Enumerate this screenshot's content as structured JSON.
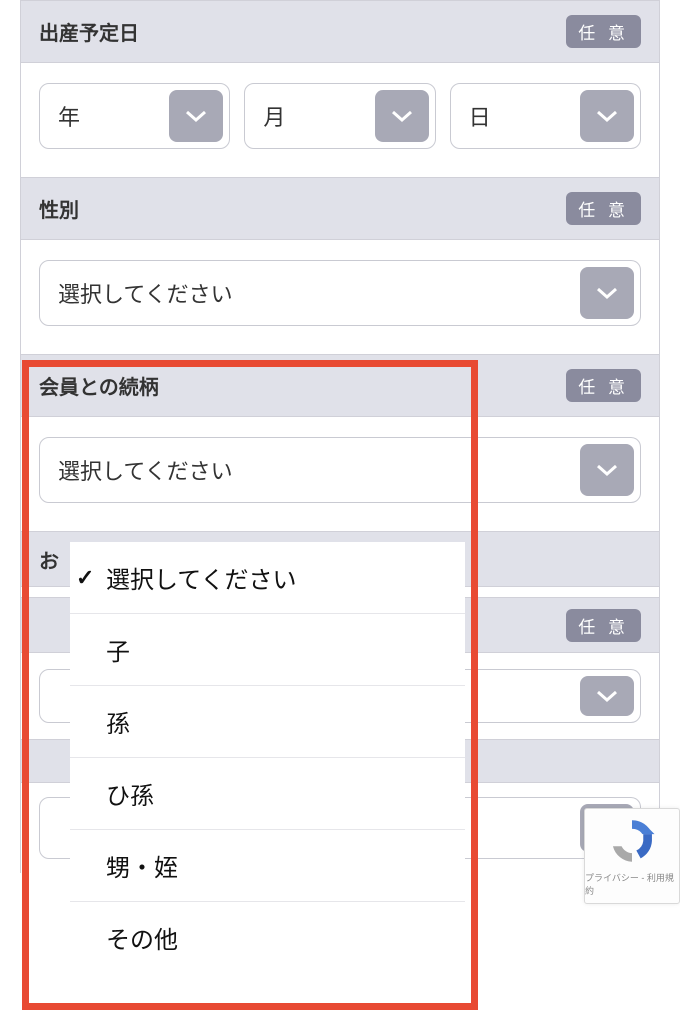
{
  "badges": {
    "optional": "任 意"
  },
  "sections": {
    "dueDate": {
      "label": "出産予定日",
      "year": "年",
      "month": "月",
      "day": "日"
    },
    "gender": {
      "label": "性別",
      "placeholder": "選択してください"
    },
    "relation": {
      "label": "会員との続柄",
      "placeholder": "選択してください",
      "options": [
        "選択してください",
        "子",
        "孫",
        "ひ孫",
        "甥・姪",
        "その他"
      ],
      "selectedIndex": 0
    }
  },
  "partialLetters": {
    "o": "お"
  },
  "recaptcha": {
    "footer": "プライバシー - 利用規約"
  }
}
